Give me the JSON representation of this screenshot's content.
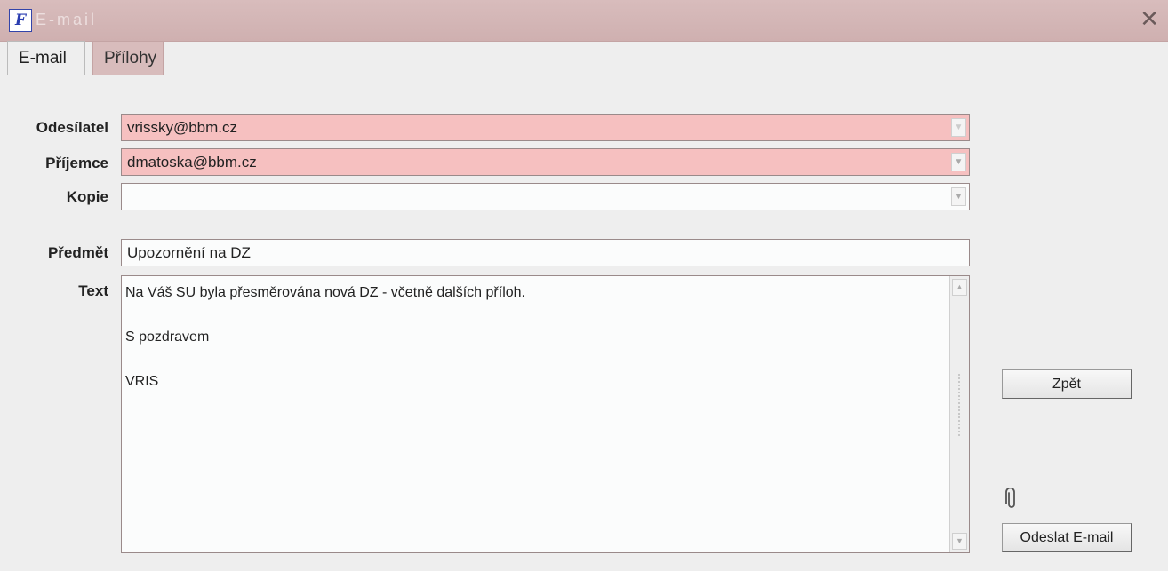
{
  "window": {
    "title": "E-mail"
  },
  "tabs": [
    {
      "label": "E-mail",
      "active": true
    },
    {
      "label": "Přílohy",
      "active": false
    }
  ],
  "form": {
    "sender": {
      "label": "Odesílatel",
      "value": "vrissky@bbm.cz"
    },
    "recipient": {
      "label": "Příjemce",
      "value": "dmatoska@bbm.cz"
    },
    "cc": {
      "label": "Kopie",
      "value": ""
    },
    "subject": {
      "label": "Předmět",
      "value": "Upozornění na DZ"
    },
    "text": {
      "label": "Text",
      "line1": "Na Váš SU byla přesměrována nová DZ - včetně dalších příloh.",
      "line2": "",
      "line3": "S pozdravem",
      "line4": "",
      "line5": "VRIS"
    }
  },
  "buttons": {
    "back": "Zpět",
    "send": "Odeslat E-mail"
  },
  "icons": {
    "app": "app-logo-icon",
    "close": "close-icon",
    "attachment": "paperclip-icon"
  },
  "colors": {
    "required_field": "#f6c0c0",
    "titlebar": "#d8bcbc"
  }
}
